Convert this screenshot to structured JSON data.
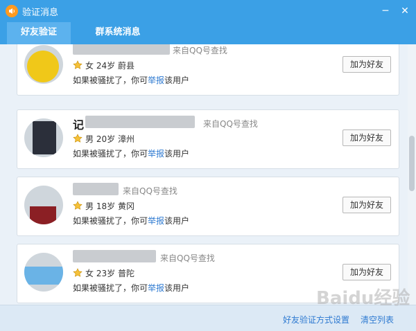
{
  "window": {
    "title": "验证消息",
    "minimize": "─",
    "close": "✕"
  },
  "tabs": [
    {
      "label": "好友验证"
    },
    {
      "label": "群系统消息"
    }
  ],
  "cards": [
    {
      "name": "",
      "source": "来自QQ号查找",
      "gender": "女",
      "age": "24岁",
      "location": "蔚县",
      "warn_before": "如果被骚扰了，你可",
      "warn_link": "举报",
      "warn_after": "该用户",
      "button": "加为好友"
    },
    {
      "name": "记",
      "source": "来自QQ号查找",
      "gender": "男",
      "age": "20岁",
      "location": "漳州",
      "warn_before": "如果被骚扰了，你可",
      "warn_link": "举报",
      "warn_after": "该用户",
      "button": "加为好友"
    },
    {
      "name": "",
      "source": "来自QQ号查找",
      "gender": "男",
      "age": "18岁",
      "location": "黄冈",
      "warn_before": "如果被骚扰了，你可",
      "warn_link": "举报",
      "warn_after": "该用户",
      "button": "加为好友"
    },
    {
      "name": "",
      "source": "来自QQ号查找",
      "gender": "女",
      "age": "23岁",
      "location": "普陀",
      "warn_before": "如果被骚扰了，你可",
      "warn_link": "举报",
      "warn_after": "该用户",
      "button": "加为好友"
    }
  ],
  "footer": {
    "settings_link": "好友验证方式设置",
    "clear_link": "清空列表"
  },
  "watermark": "Baidu经验",
  "colors": {
    "header_blue": "#3ba0e6",
    "link_blue": "#2e7ad1"
  }
}
